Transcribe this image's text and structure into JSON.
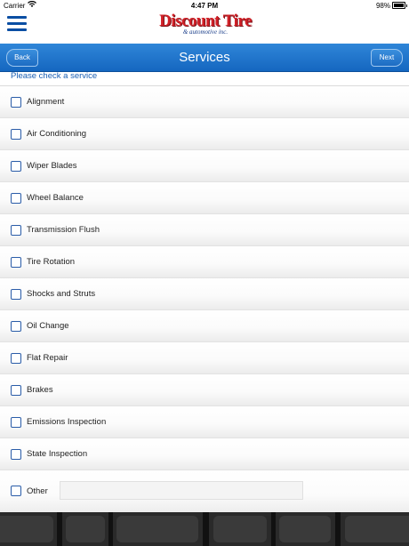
{
  "status_bar": {
    "carrier": "Carrier",
    "time": "4:47 PM",
    "battery": "98%",
    "battery_level": 0.98
  },
  "header": {
    "logo_text": "Discount Tire",
    "logo_sub": "& automotive inc."
  },
  "navbar": {
    "title": "Services",
    "back_label": "Back",
    "next_label": "Next"
  },
  "prompt": "Please check a service",
  "services": [
    {
      "label": "Alignment",
      "checked": false
    },
    {
      "label": "Air Conditioning",
      "checked": false
    },
    {
      "label": "Wiper Blades",
      "checked": false
    },
    {
      "label": "Wheel Balance",
      "checked": false
    },
    {
      "label": "Transmission Flush",
      "checked": false
    },
    {
      "label": "Tire Rotation",
      "checked": false
    },
    {
      "label": "Shocks and Struts",
      "checked": false
    },
    {
      "label": "Oil Change",
      "checked": false
    },
    {
      "label": "Flat Repair",
      "checked": false
    },
    {
      "label": "Brakes",
      "checked": false
    },
    {
      "label": "Emissions Inspection",
      "checked": false
    },
    {
      "label": "State Inspection",
      "checked": false
    }
  ],
  "other": {
    "label": "Other",
    "value": "",
    "checked": false
  },
  "colors": {
    "nav_blue": "#1567c0",
    "link_blue": "#1a5fb4",
    "logo_red": "#d12027"
  },
  "icons": {
    "menu": "hamburger-icon",
    "wifi": "wifi-icon",
    "battery": "battery-icon"
  }
}
